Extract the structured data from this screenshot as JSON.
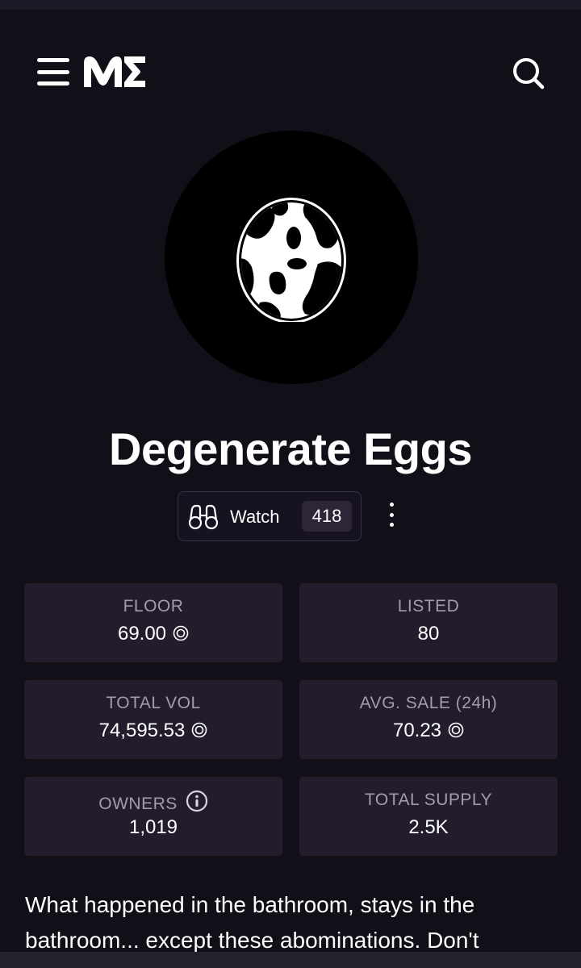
{
  "header": {
    "logo_text": "ME"
  },
  "collection": {
    "name": "Degenerate Eggs"
  },
  "watch": {
    "label": "Watch",
    "count": "418"
  },
  "stats": {
    "floor": {
      "label": "FLOOR",
      "value": "69.00"
    },
    "listed": {
      "label": "LISTED",
      "value": "80"
    },
    "total_vol": {
      "label": "TOTAL VOL",
      "value": "74,595.53"
    },
    "avg_sale": {
      "label": "AVG. SALE (24h)",
      "value": "70.23"
    },
    "owners": {
      "label": "OWNERS",
      "value": "1,019"
    },
    "total_supply": {
      "label": "TOTAL SUPPLY",
      "value": "2.5K"
    }
  },
  "description": "What happened in the bathroom, stays in the bathroom... except these abominations. Don't",
  "icons": {
    "menu": "menu-icon",
    "search": "search-icon",
    "watch": "binoculars-icon",
    "more": "more-vertical-icon",
    "currency": "sol-icon",
    "info": "info-icon"
  },
  "colors": {
    "background": "#120f18",
    "card": "#221c2c",
    "label": "#a39cb0",
    "text": "#ffffff"
  }
}
